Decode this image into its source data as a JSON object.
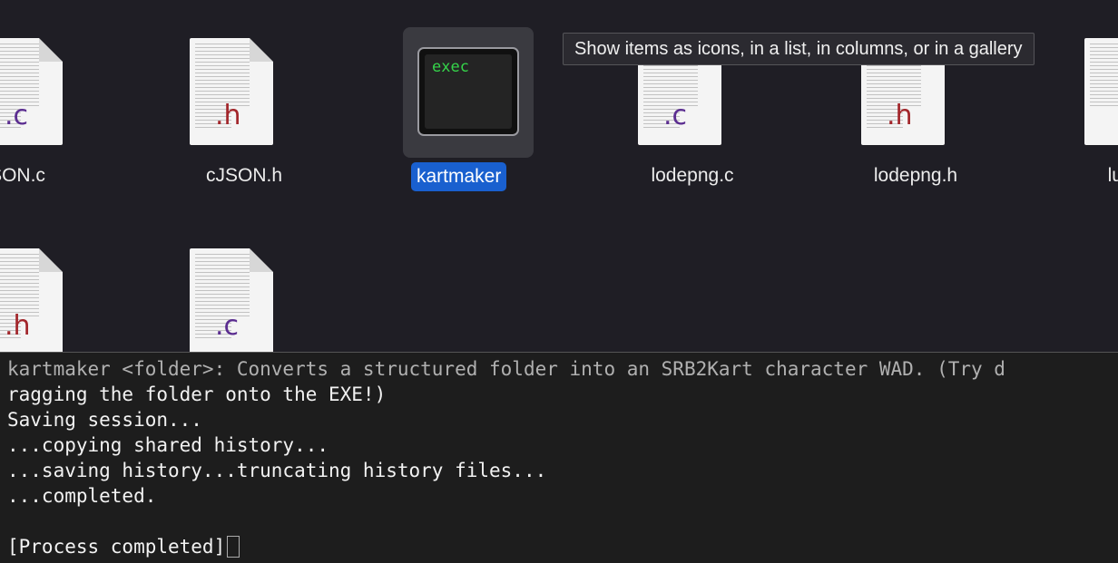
{
  "finder": {
    "files_row1": [
      {
        "name": "SON.c",
        "ext": ".c"
      },
      {
        "name": "cJSON.h",
        "ext": ".h"
      },
      {
        "name": "kartmaker",
        "kind": "exec",
        "icon_text": "exec"
      },
      {
        "name": "lodepng.c",
        "ext": ".c"
      },
      {
        "name": "lodepng.h",
        "ext": ".h"
      },
      {
        "name": "lu",
        "ext": ""
      }
    ],
    "files_row2": [
      {
        "ext": ".h"
      },
      {
        "ext": ".c"
      }
    ],
    "tooltip": "Show items as icons, in a list, in columns, or in a gallery"
  },
  "terminal": {
    "lines": [
      "kartmaker <folder>: Converts a structured folder into an SRB2Kart character WAD. (Try d",
      "ragging the folder onto the EXE!)",
      "Saving session...",
      "...copying shared history...",
      "...saving history...truncating history files...",
      "...completed.",
      "",
      "[Process completed]"
    ]
  },
  "colors": {
    "background": "#1f1e25",
    "selection": "#1960cf",
    "c_ext": "#5b2d90",
    "h_ext": "#a2262b",
    "exec_text": "#35d44a"
  },
  "icons": {
    "source_file": "document-icon",
    "executable": "terminal-exec-icon"
  }
}
